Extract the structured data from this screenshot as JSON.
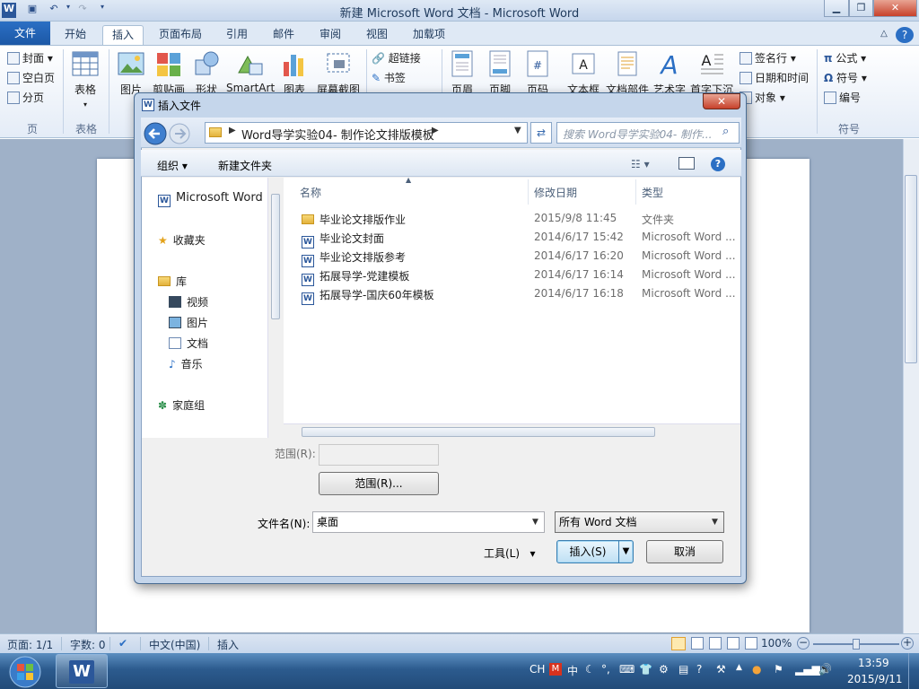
{
  "window": {
    "title": "新建 Microsoft Word 文档 - Microsoft Word",
    "help_glyph": "?"
  },
  "ribbon_tabs": [
    "文件",
    "开始",
    "插入",
    "页面布局",
    "引用",
    "邮件",
    "审阅",
    "视图",
    "加载项"
  ],
  "ribbon": {
    "pages_group": {
      "items": [
        "封面",
        "空白页",
        "分页"
      ],
      "name": "页"
    },
    "tables_group": {
      "label": "表格",
      "name": "表格"
    },
    "illustrations": [
      "图片",
      "剪贴画",
      "形状",
      "SmartArt",
      "图表",
      "屏幕截图"
    ],
    "links": [
      "超链接",
      "书签"
    ],
    "header_footer": [
      "页眉",
      "页脚",
      "页码"
    ],
    "text": [
      "文本框",
      "文档部件",
      "艺术字",
      "首字下沉"
    ],
    "text_small": [
      "签名行",
      "日期和时间",
      "对象"
    ],
    "symbols": {
      "items": [
        "公式",
        "符号",
        "编号"
      ],
      "name": "符号"
    }
  },
  "dialog": {
    "title": "插入文件",
    "close_glyph": "✕",
    "breadcrumb": "Word导学实验04- 制作论文排版模板",
    "search_placeholder": "搜索 Word导学实验04- 制作...",
    "organize": "组织",
    "new_folder": "新建文件夹",
    "nav": {
      "app": "Microsoft Word",
      "favorites": "收藏夹",
      "library": "库",
      "library_items": [
        "视频",
        "图片",
        "文档",
        "音乐"
      ],
      "homegroup": "家庭组"
    },
    "columns": {
      "name": "名称",
      "date": "修改日期",
      "type": "类型"
    },
    "files": [
      {
        "name": "毕业论文排版作业",
        "date": "2015/9/8 11:45",
        "type": "文件夹",
        "kind": "folder"
      },
      {
        "name": "毕业论文封面",
        "date": "2014/6/17 15:42",
        "type": "Microsoft Word ...",
        "kind": "word"
      },
      {
        "name": "毕业论文排版参考",
        "date": "2014/6/17 16:20",
        "type": "Microsoft Word ...",
        "kind": "word"
      },
      {
        "name": "拓展导学-党建模板",
        "date": "2014/6/17 16:14",
        "type": "Microsoft Word ...",
        "kind": "word"
      },
      {
        "name": "拓展导学-国庆60年模板",
        "date": "2014/6/17 16:18",
        "type": "Microsoft Word ...",
        "kind": "word"
      }
    ],
    "range_label": "范围(R):",
    "range_button": "范围(R)...",
    "filename_label": "文件名(N):",
    "filename_value": "桌面",
    "filetype_value": "所有 Word 文档",
    "tools": "工具(L)",
    "insert_button": "插入(S)",
    "cancel_button": "取消"
  },
  "status": {
    "page": "页面: 1/1",
    "words": "字数: 0",
    "language": "中文(中国)",
    "mode": "插入",
    "zoom": "100%"
  },
  "taskbar": {
    "lang": "CH",
    "time": "13:59",
    "date": "2015/9/11"
  },
  "colors": {
    "accent": "#1c58a6",
    "dialog_frame": "#c5d6eb",
    "taskbar": "#2c5b8e"
  }
}
